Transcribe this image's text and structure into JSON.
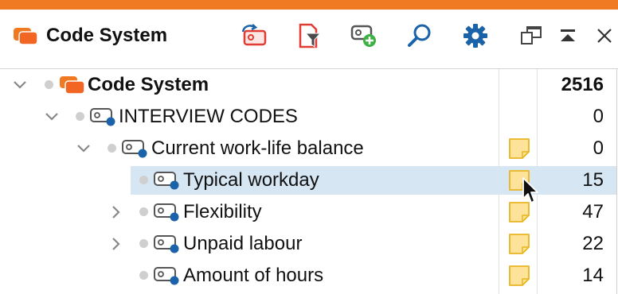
{
  "window": {
    "title": "Code System",
    "accent_color": "#f07a22"
  },
  "toolbar": {
    "buttons": [
      {
        "name": "activate-codes-button",
        "icon": "code-reset-icon"
      },
      {
        "name": "filter-button",
        "icon": "document-filter-icon"
      },
      {
        "name": "new-code-button",
        "icon": "code-add-icon"
      },
      {
        "name": "search-button",
        "icon": "search-icon"
      },
      {
        "name": "settings-button",
        "icon": "gear-icon"
      },
      {
        "name": "undock-button",
        "icon": "undock-window-icon"
      },
      {
        "name": "maximize-button",
        "icon": "maximize-icon"
      },
      {
        "name": "close-button",
        "icon": "close-icon"
      }
    ]
  },
  "tree": {
    "rows": [
      {
        "label": "Code System",
        "count": "2516",
        "level": 0,
        "expanded": true,
        "root": true,
        "memo": false
      },
      {
        "label": "INTERVIEW CODES",
        "count": "0",
        "level": 1,
        "expanded": true,
        "memo": false
      },
      {
        "label": "Current work-life balance",
        "count": "0",
        "level": 2,
        "expanded": true,
        "memo": true
      },
      {
        "label": "Typical workday",
        "count": "15",
        "level": 3,
        "selected": true,
        "memo": true
      },
      {
        "label": "Flexibility",
        "count": "47",
        "level": 3,
        "expanded": false,
        "memo": true
      },
      {
        "label": "Unpaid labour",
        "count": "22",
        "level": 3,
        "expanded": false,
        "memo": true
      },
      {
        "label": "Amount of hours",
        "count": "14",
        "level": 3,
        "memo": true
      }
    ]
  },
  "colors": {
    "selection": "#d6e6f3",
    "code_dot": "#1a63a8",
    "memo_fill": "#fde39a",
    "memo_stroke": "#e8b520",
    "root_icon": "#f26522"
  }
}
